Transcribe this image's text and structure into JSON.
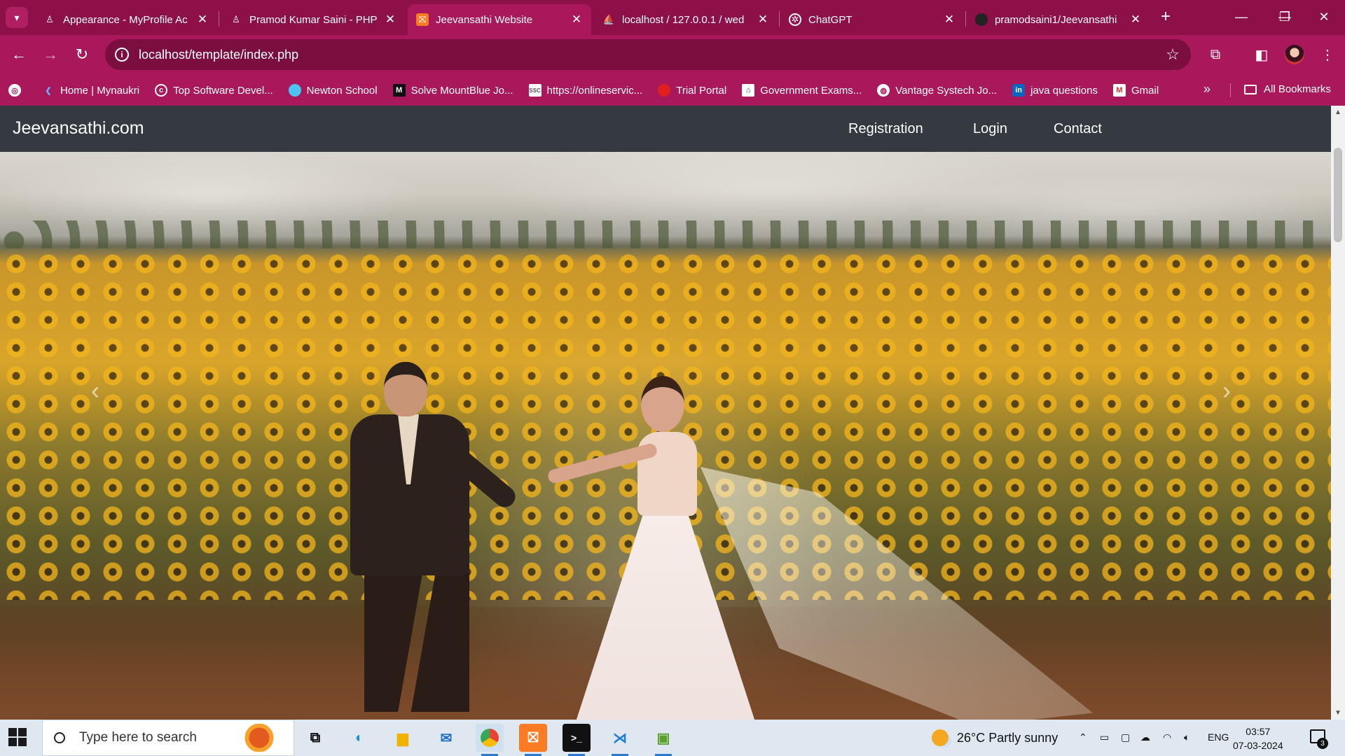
{
  "browser": {
    "tabs": [
      {
        "title": "Appearance - MyProfile Ac",
        "icon": "profile-icon"
      },
      {
        "title": "Pramod Kumar Saini - PHP",
        "icon": "profile-icon"
      },
      {
        "title": "Jeevansathi Website",
        "icon": "xampp-icon",
        "active": true
      },
      {
        "title": "localhost / 127.0.0.1 / wed",
        "icon": "phpmyadmin-icon"
      },
      {
        "title": "ChatGPT",
        "icon": "chatgpt-icon"
      },
      {
        "title": "pramodsaini1/Jeevansathi",
        "icon": "github-icon"
      }
    ],
    "url": "localhost/template/index.php",
    "bookmarks": [
      {
        "label": "",
        "icon": "chrome-icon"
      },
      {
        "label": "Home | Mynaukri",
        "icon": "mynaukri-icon"
      },
      {
        "label": "Top Software Devel...",
        "icon": "site-icon"
      },
      {
        "label": "Newton School",
        "icon": "newton-icon"
      },
      {
        "label": "Solve MountBlue Jo...",
        "icon": "mountblue-icon"
      },
      {
        "label": "https://onlineservic...",
        "icon": "ssc-icon"
      },
      {
        "label": "Trial Portal",
        "icon": "trial-icon"
      },
      {
        "label": "Government Exams...",
        "icon": "gov-icon"
      },
      {
        "label": "Vantage Systech Jo...",
        "icon": "globe-icon"
      },
      {
        "label": "java questions",
        "icon": "linkedin-icon"
      },
      {
        "label": "Gmail",
        "icon": "gmail-icon"
      }
    ],
    "all_bookmarks": "All Bookmarks"
  },
  "site": {
    "brand": "Jeevansathi.com",
    "nav": [
      "Registration",
      "Login",
      "Contact"
    ]
  },
  "taskbar": {
    "search_placeholder": "Type here to search",
    "weather": "26°C  Partly sunny",
    "lang": "ENG",
    "time": "03:57",
    "date": "07-03-2024",
    "notifications": "3"
  },
  "colors": {
    "chrome": "#a8185a",
    "tabstrip": "#8e1049",
    "site_nav": "#343a40"
  }
}
